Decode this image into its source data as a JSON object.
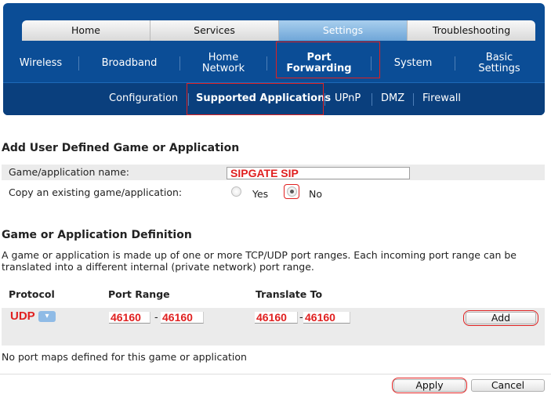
{
  "top_tabs": [
    "Home",
    "Services",
    "Settings",
    "Troubleshooting"
  ],
  "main_nav": {
    "wireless": "Wireless",
    "broadband": "Broadband",
    "home_network_1": "Home",
    "home_network_2": "Network",
    "port_forwarding_1": "Port",
    "port_forwarding_2": "Forwarding",
    "system": "System",
    "basic_settings_1": "Basic",
    "basic_settings_2": "Settings"
  },
  "sub_nav": [
    "Configuration",
    "Supported Applications",
    "UPnP",
    "DMZ",
    "Firewall"
  ],
  "section1": {
    "title": "Add User Defined Game or Application",
    "name_label": "Game/application name:",
    "name_value": "SIPGATE SIP",
    "copy_label": "Copy an existing game/application:",
    "yes_label": "Yes",
    "no_label": "No",
    "copy_selected": "No"
  },
  "section2": {
    "title": "Game or Application Definition",
    "description": "A game or application is made up of one or more TCP/UDP port ranges. Each incoming port range can be translated into a different internal (private network) port range.",
    "headers": {
      "protocol": "Protocol",
      "port_range": "Port Range",
      "translate_to": "Translate To"
    },
    "protocol_value": "UDP",
    "port_from": "46160",
    "port_to": "46160",
    "translate_from": "46160",
    "translate_to": "46160",
    "dash": "-",
    "add_label": "Add",
    "no_maps": "No port maps defined for this game or application"
  },
  "footer": {
    "apply_label": "Apply",
    "cancel_label": "Cancel"
  },
  "colors": {
    "header_blue": "#0b4d96",
    "highlight_red": "#e02020",
    "tab_active": "#6fa6d8"
  }
}
